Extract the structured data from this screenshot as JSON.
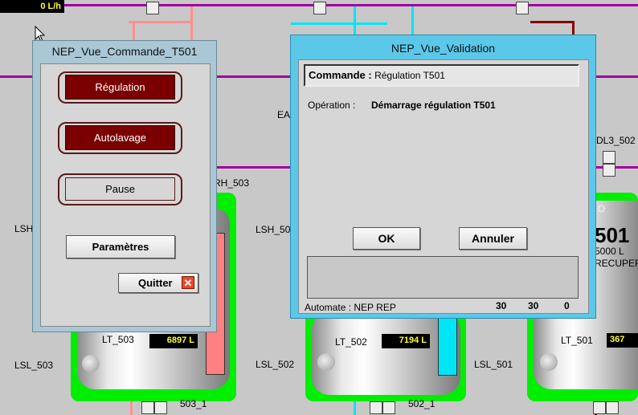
{
  "scada": {
    "flow_display": "0 L/h",
    "ea_label": "EA",
    "dl_label": "DL3_502",
    "rh_label": "RH_503",
    "lsh_left": "LSH",
    "lsh_mid": "LSH_50",
    "lsl_503": "LSL_503",
    "lsl_502": "LSL_502",
    "lsl_501": "LSL_501",
    "lt_503": "LT_503",
    "lt_503_value": "6897 L",
    "lt_502": "LT_502",
    "lt_502_value": "7194 L",
    "lt_501": "LT_501",
    "lt_501_value": "367",
    "tank_501_title": "501",
    "tank_501_capacity": "5000 L",
    "tank_501_name": "RECUPER",
    "outlet_503": "503_1",
    "outlet_502": "502_1"
  },
  "commande_window": {
    "title": "NEP_Vue_Commande_T501",
    "regulation_label": "Régulation",
    "autolavage_label": "Autolavage",
    "pause_label": "Pause",
    "parametres_label": "Paramètres",
    "quitter_label": "Quitter"
  },
  "validation_window": {
    "title": "NEP_Vue_Validation",
    "commande_label": "Commande :",
    "commande_value": "Régulation T501",
    "operation_label": "Opération :",
    "operation_value": "Démarrage régulation T501",
    "ok_label": "OK",
    "annuler_label": "Annuler",
    "automate_label": "Automate : NEP REP",
    "counter_1": "30",
    "counter_2": "30",
    "counter_3": "0"
  },
  "colors": {
    "pipe_magenta": "#a000a0",
    "pipe_cyan": "#00e5f5",
    "pipe_pink": "#ff9090",
    "pipe_darkred": "#8a0000",
    "window_frame": "#5bc8ea",
    "button_red": "#7a0000"
  }
}
